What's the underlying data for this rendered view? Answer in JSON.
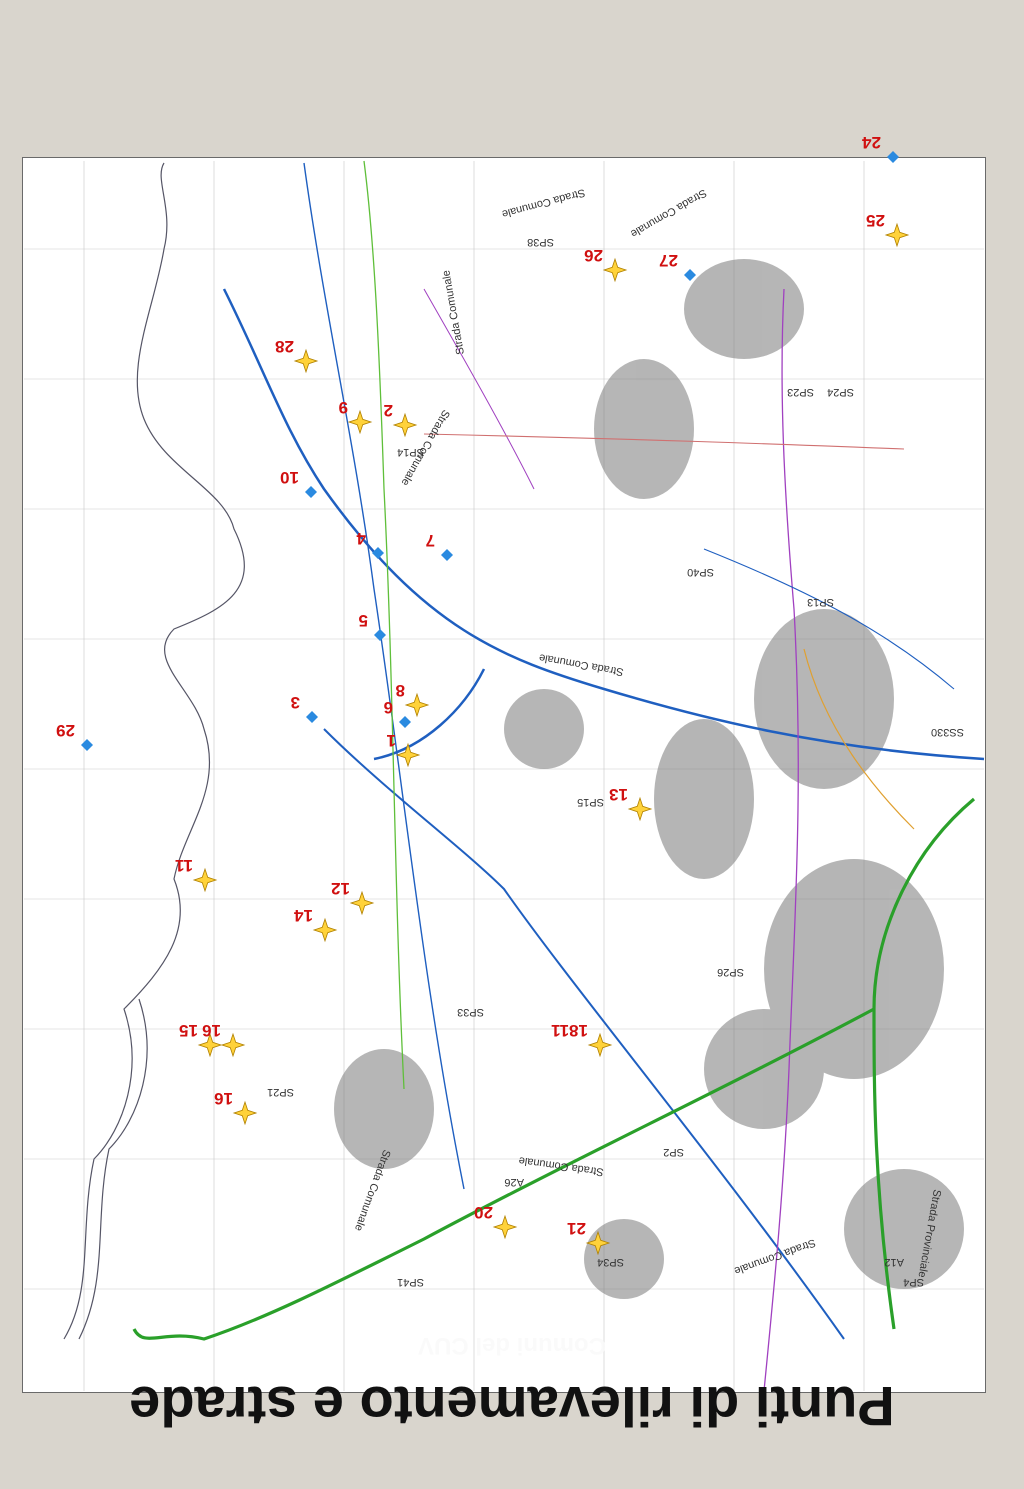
{
  "title": "Punti di rilevamento e strade",
  "subtitle": "Comuni del CUV",
  "colors": {
    "background": "#d9d5cd",
    "motorway": "#2aa02a",
    "road_blue": "#1f5fc0",
    "road_green": "#5fbf3a",
    "road_purple": "#a040c0",
    "road_orange": "#e0a030",
    "road_red": "#d07070",
    "survey_star": "#ffd23a",
    "survey_diamond": "#2a8ae0",
    "label": "#d01010"
  },
  "survey_points": [
    {
      "id": "1",
      "marker": "star",
      "label": "1"
    },
    {
      "id": "2",
      "marker": "star",
      "label": "2"
    },
    {
      "id": "3",
      "marker": "diamond",
      "label": "3"
    },
    {
      "id": "4",
      "marker": "diamond",
      "label": "4"
    },
    {
      "id": "5",
      "marker": "diamond",
      "label": "5"
    },
    {
      "id": "6",
      "marker": "diamond",
      "label": "6"
    },
    {
      "id": "7",
      "marker": "diamond",
      "label": "7"
    },
    {
      "id": "8",
      "marker": "star",
      "label": "8"
    },
    {
      "id": "9",
      "marker": "star",
      "label": "9"
    },
    {
      "id": "10",
      "marker": "diamond",
      "label": "10"
    },
    {
      "id": "11",
      "marker": "star",
      "label": "11"
    },
    {
      "id": "12",
      "marker": "star",
      "label": "12"
    },
    {
      "id": "13",
      "marker": "star",
      "label": "13"
    },
    {
      "id": "14",
      "marker": "star",
      "label": "14"
    },
    {
      "id": "15",
      "marker": "star",
      "label": "15"
    },
    {
      "id": "16",
      "marker": "star",
      "label": "16"
    },
    {
      "id": "16b",
      "marker": "star",
      "label": "16"
    },
    {
      "id": "1811",
      "marker": "star",
      "label": "1811"
    },
    {
      "id": "20",
      "marker": "star",
      "label": "20"
    },
    {
      "id": "21",
      "marker": "star",
      "label": "21"
    },
    {
      "id": "24",
      "marker": "diamond",
      "label": "24"
    },
    {
      "id": "25",
      "marker": "star",
      "label": "25"
    },
    {
      "id": "26",
      "marker": "star",
      "label": "26"
    },
    {
      "id": "27",
      "marker": "diamond",
      "label": "27"
    },
    {
      "id": "28",
      "marker": "star",
      "label": "28"
    },
    {
      "id": "29",
      "marker": "diamond",
      "label": "29"
    }
  ],
  "road_labels": [
    {
      "id": "strada-comunale-1",
      "text": "Strada Comunale"
    },
    {
      "id": "strada-comunale-2",
      "text": "Strada Comunale"
    },
    {
      "id": "strada-comunale-3",
      "text": "Strada Comunale"
    },
    {
      "id": "strada-comunale-4",
      "text": "Strada Comunale"
    },
    {
      "id": "strada-comunale-5",
      "text": "Strada Comunale"
    },
    {
      "id": "strada-comunale-6",
      "text": "Strada Comunale"
    },
    {
      "id": "strada-comunale-7",
      "text": "Strada Comunale"
    },
    {
      "id": "strada-comunale-8",
      "text": "Strada Comunale"
    },
    {
      "id": "strada-provinciale",
      "text": "Strada Provinciale"
    },
    {
      "id": "sp38",
      "text": "SP38"
    },
    {
      "id": "sp23",
      "text": "SP23"
    },
    {
      "id": "sp24",
      "text": "SP24"
    },
    {
      "id": "sp14",
      "text": "SP14"
    },
    {
      "id": "sp40",
      "text": "SP40"
    },
    {
      "id": "sp13",
      "text": "SP13"
    },
    {
      "id": "sp15",
      "text": "SP15"
    },
    {
      "id": "sp21",
      "text": "SP21"
    },
    {
      "id": "sp33",
      "text": "SP33"
    },
    {
      "id": "sp26",
      "text": "SP26"
    },
    {
      "id": "sp34",
      "text": "SP34"
    },
    {
      "id": "sp41",
      "text": "SP41"
    },
    {
      "id": "sp4",
      "text": "SP4"
    },
    {
      "id": "sp2",
      "text": "SP2"
    },
    {
      "id": "ss330",
      "text": "SS330"
    },
    {
      "id": "a26",
      "text": "A26"
    },
    {
      "id": "a12",
      "text": "A12"
    }
  ]
}
